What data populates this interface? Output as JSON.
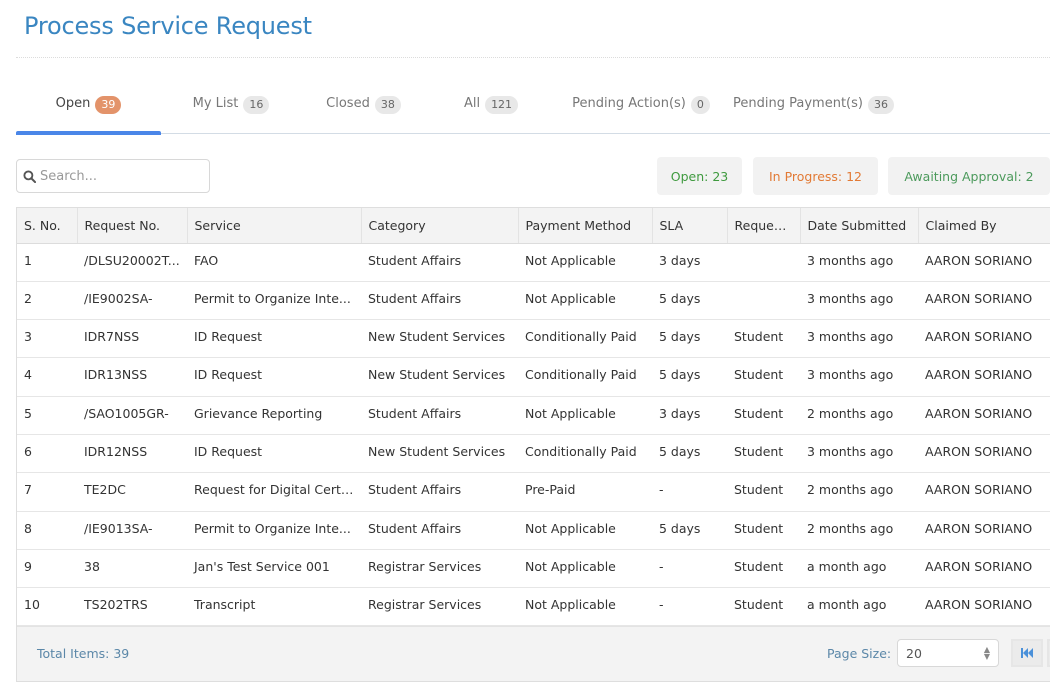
{
  "page": {
    "title": "Process Service Request"
  },
  "tabs": [
    {
      "label": "Open",
      "count": "39",
      "active": true
    },
    {
      "label": "My List",
      "count": "16"
    },
    {
      "label": "Closed",
      "count": "38"
    },
    {
      "label": "All",
      "count": "121"
    },
    {
      "label": "Pending Action(s)",
      "count": "0"
    },
    {
      "label": "Pending Payment(s)",
      "count": "36"
    }
  ],
  "search": {
    "placeholder": "Search...",
    "value": "",
    "icon": "search-icon"
  },
  "status_summary": {
    "open": {
      "label": "Open: 23",
      "color": "#3f9a3f"
    },
    "in_progress": {
      "label": "In Progress: 12",
      "color": "#e27a35"
    },
    "awaiting_approval": {
      "label": "Awaiting Approval: 2",
      "color": "#4c9a5c"
    }
  },
  "table": {
    "columns": [
      "S. No.",
      "Request No.",
      "Service",
      "Category",
      "Payment Method",
      "SLA",
      "Request...",
      "Date Submitted",
      "Claimed By"
    ],
    "rows": [
      [
        "1",
        "/DLSU20002T...",
        "FAO",
        "Student Affairs",
        "Not Applicable",
        "3 days",
        "",
        "3 months ago",
        "AARON SORIANO"
      ],
      [
        "2",
        "/IE9002SA-",
        "Permit to Organize Inte...",
        "Student Affairs",
        "Not Applicable",
        "5 days",
        "",
        "3 months ago",
        "AARON SORIANO"
      ],
      [
        "3",
        "IDR7NSS",
        "ID Request",
        "New Student Services",
        "Conditionally Paid",
        "5 days",
        "Student",
        "3 months ago",
        "AARON SORIANO"
      ],
      [
        "4",
        "IDR13NSS",
        "ID Request",
        "New Student Services",
        "Conditionally Paid",
        "5 days",
        "Student",
        "3 months ago",
        "AARON SORIANO"
      ],
      [
        "5",
        "/SAO1005GR-",
        "Grievance Reporting",
        "Student Affairs",
        "Not Applicable",
        "3 days",
        "Student",
        "2 months ago",
        "AARON SORIANO"
      ],
      [
        "6",
        "IDR12NSS",
        "ID Request",
        "New Student Services",
        "Conditionally Paid",
        "5 days",
        "Student",
        "3 months ago",
        "AARON SORIANO"
      ],
      [
        "7",
        "TE2DC",
        "Request for Digital Certi...",
        "Student Affairs",
        "Pre-Paid",
        "-",
        "Student",
        "2 months ago",
        "AARON SORIANO"
      ],
      [
        "8",
        "/IE9013SA-",
        "Permit to Organize Inte...",
        "Student Affairs",
        "Not Applicable",
        "5 days",
        "Student",
        "2 months ago",
        "AARON SORIANO"
      ],
      [
        "9",
        "38",
        "Jan's Test Service 001",
        "Registrar Services",
        "Not Applicable",
        "-",
        "Student",
        "a month ago",
        "AARON SORIANO"
      ],
      [
        "10",
        "TS202TRS",
        "Transcript",
        "Registrar Services",
        "Not Applicable",
        "-",
        "Student",
        "a month ago",
        "AARON SORIANO"
      ]
    ]
  },
  "pager": {
    "total_items": "Total Items: 39",
    "page_size_label": "Page Size:",
    "page_size_value": "20",
    "first_page_icon": "first-page-icon"
  },
  "colors": {
    "title": "#3a86c1",
    "active_tab_indicator": "#4a86e8",
    "active_badge": "#e3936a",
    "pager_text": "#5b87a8"
  }
}
